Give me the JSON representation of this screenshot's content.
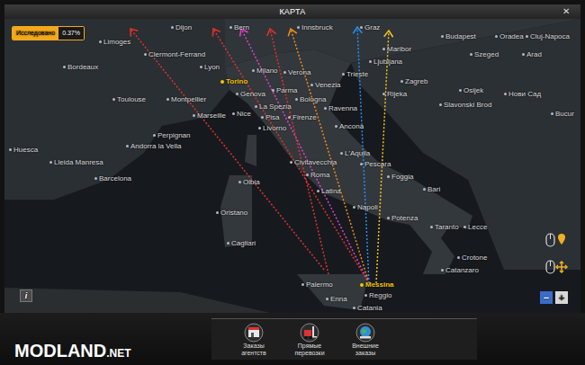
{
  "window": {
    "title": "КАРТА",
    "close": "✕"
  },
  "explored": {
    "label": "Исследовано",
    "value": "0.37%"
  },
  "map": {
    "cities": [
      {
        "name": "Dijon",
        "highlight": false
      },
      {
        "name": "Bern",
        "highlight": false
      },
      {
        "name": "Innsbruck",
        "highlight": false
      },
      {
        "name": "Graz",
        "highlight": false
      },
      {
        "name": "Budapest",
        "highlight": false
      },
      {
        "name": "Oradea",
        "highlight": false
      },
      {
        "name": "Cluj-Napoca",
        "highlight": false
      },
      {
        "name": "Limoges",
        "highlight": false
      },
      {
        "name": "Maribor",
        "highlight": false
      },
      {
        "name": "Clermont-Ferrand",
        "highlight": false
      },
      {
        "name": "Szeged",
        "highlight": false
      },
      {
        "name": "Arad",
        "highlight": false
      },
      {
        "name": "Bordeaux",
        "highlight": false
      },
      {
        "name": "Lyon",
        "highlight": false
      },
      {
        "name": "Milano",
        "highlight": false
      },
      {
        "name": "Verona",
        "highlight": false
      },
      {
        "name": "Trieste",
        "highlight": false
      },
      {
        "name": "Ljubljana",
        "highlight": false
      },
      {
        "name": "Torino",
        "highlight": true
      },
      {
        "name": "Zagreb",
        "highlight": false
      },
      {
        "name": "Venezia",
        "highlight": false
      },
      {
        "name": "Parma",
        "highlight": false
      },
      {
        "name": "Osijek",
        "highlight": false
      },
      {
        "name": "Нови Сад",
        "highlight": false
      },
      {
        "name": "Rijeka",
        "highlight": false
      },
      {
        "name": "Genova",
        "highlight": false
      },
      {
        "name": "Toulouse",
        "highlight": false
      },
      {
        "name": "Montpellier",
        "highlight": false
      },
      {
        "name": "Bologna",
        "highlight": false
      },
      {
        "name": "Slavonski Brod",
        "highlight": false
      },
      {
        "name": "La Spezia",
        "highlight": false
      },
      {
        "name": "Ravenna",
        "highlight": false
      },
      {
        "name": "Nice",
        "highlight": false
      },
      {
        "name": "Marseille",
        "highlight": false
      },
      {
        "name": "Bucur",
        "highlight": false
      },
      {
        "name": "Pisa",
        "highlight": false
      },
      {
        "name": "Firenze",
        "highlight": false
      },
      {
        "name": "Ancona",
        "highlight": false
      },
      {
        "name": "Livorno",
        "highlight": false
      },
      {
        "name": "Perpignan",
        "highlight": false
      },
      {
        "name": "Andorra la Vella",
        "highlight": false
      },
      {
        "name": "Huesca",
        "highlight": false
      },
      {
        "name": "L'Aquila",
        "highlight": false
      },
      {
        "name": "Civitavecchia",
        "highlight": false
      },
      {
        "name": "Lleida Manresa",
        "highlight": false
      },
      {
        "name": "Pescara",
        "highlight": false
      },
      {
        "name": "Roma",
        "highlight": false
      },
      {
        "name": "Foggia",
        "highlight": false
      },
      {
        "name": "Barcelona",
        "highlight": false
      },
      {
        "name": "Olbia",
        "highlight": false
      },
      {
        "name": "Bari",
        "highlight": false
      },
      {
        "name": "Latina",
        "highlight": false
      },
      {
        "name": "Napoli",
        "highlight": false
      },
      {
        "name": "Oristano",
        "highlight": false
      },
      {
        "name": "Potenza",
        "highlight": false
      },
      {
        "name": "Taranto",
        "highlight": false
      },
      {
        "name": "Lecce",
        "highlight": false
      },
      {
        "name": "Cagliari",
        "highlight": false
      },
      {
        "name": "Crotone",
        "highlight": false
      },
      {
        "name": "Catanzaro",
        "highlight": false
      },
      {
        "name": "Palermo",
        "highlight": false
      },
      {
        "name": "Messina",
        "highlight": true
      },
      {
        "name": "Reggio",
        "highlight": false
      },
      {
        "name": "Enna",
        "highlight": false
      },
      {
        "name": "Catania",
        "highlight": false
      }
    ],
    "routes": [
      {
        "color": "#e0322c"
      },
      {
        "color": "#e0322c"
      },
      {
        "color": "#e040c8"
      },
      {
        "color": "#e0322c"
      },
      {
        "color": "#f08a1c"
      },
      {
        "color": "#2a8cf0"
      },
      {
        "color": "#f0c020"
      }
    ]
  },
  "controls": {
    "info": "i",
    "zoom_out": "−",
    "zoom_in": "+"
  },
  "toolbar": [
    {
      "label": "Заказы агентств",
      "kind": "agency"
    },
    {
      "label": "Прямые перевозки",
      "kind": "direct"
    },
    {
      "label": "Внешние заказы",
      "kind": "external"
    }
  ],
  "watermark": {
    "name": "MODLAND",
    "suffix": ".NET"
  }
}
